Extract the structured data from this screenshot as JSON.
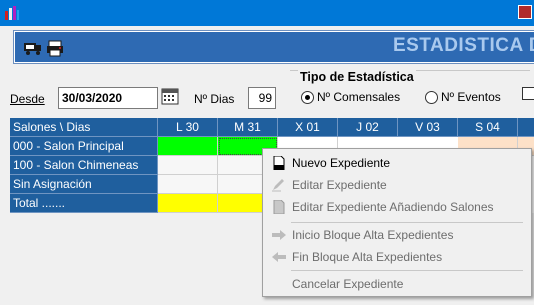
{
  "header": {
    "title": "ESTADISTICA D"
  },
  "filters": {
    "desde_label": "Desde",
    "desde_value": "30/03/2020",
    "dias_label": "Nº Dias",
    "dias_value": "99"
  },
  "tipo": {
    "title": "Tipo de Estadística",
    "options": [
      {
        "label": "Nº Comensales",
        "selected": true
      },
      {
        "label": "Nº Eventos",
        "selected": false
      }
    ]
  },
  "grid": {
    "corner": "Salones \\ Dias",
    "days": [
      "L 30",
      "M 31",
      "X 01",
      "J 02",
      "V 03",
      "S 04"
    ],
    "rows": [
      {
        "label": "000 - Salon Principal"
      },
      {
        "label": "100 - Salon Chimeneas"
      },
      {
        "label": "Sin Asignación"
      },
      {
        "label": "Total ......."
      }
    ],
    "colors": {
      "header": "#1f5f9e",
      "green": "#00ff00",
      "yellow": "#ffff00",
      "weekend": "#fde1c8"
    }
  },
  "context_menu": {
    "items": [
      {
        "label": "Nuevo Expediente",
        "enabled": true,
        "icon": "new-document-icon"
      },
      {
        "label": "Editar Expediente",
        "enabled": false,
        "icon": "edit-pencil-icon"
      },
      {
        "label": "Editar Expediente Añadiendo Salones",
        "enabled": false,
        "icon": "document-add-icon"
      },
      {
        "label": "Inicio Bloque Alta Expedientes",
        "enabled": false,
        "icon": "arrow-right-icon"
      },
      {
        "label": "Fin Bloque Alta Expedientes",
        "enabled": false,
        "icon": "arrow-left-icon"
      },
      {
        "label": "Cancelar Expediente",
        "enabled": false,
        "icon": ""
      }
    ]
  }
}
